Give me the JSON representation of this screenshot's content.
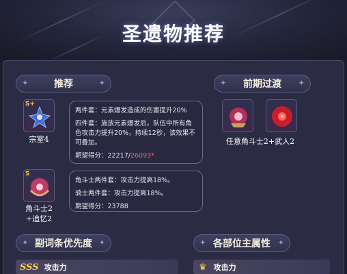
{
  "page": {
    "title": "圣遗物推荐"
  },
  "sections": {
    "recommend": "推荐",
    "early": "前期过渡",
    "substats": "副词条优先度",
    "main_stats": "各部位主属性"
  },
  "recommend": [
    {
      "badge": "S+",
      "name": "宗室4",
      "lines": [
        "两件套：元素爆发造成的伤害提升20%",
        "四件套：施放元素爆发后，队伍中所有角色攻击力提升20%，持续12秒，该效果不可叠加。"
      ],
      "score_label": "期望得分：",
      "score_a": "22217",
      "score_sep": "/",
      "score_b": "26093*"
    },
    {
      "badge": "S",
      "name": "角斗士2\n+追忆2",
      "lines": [
        "角斗士两件套：攻击力提高18%。",
        "骑士两件套：攻击力提高18%。"
      ],
      "score_label": "期望得分：",
      "score": "23788"
    }
  ],
  "early": {
    "label": "任意角斗士2+武人2"
  },
  "substat_top": {
    "rank": "SSS",
    "label": "攻击力"
  },
  "main_stat_top": {
    "label": "攻击力"
  },
  "colors": {
    "accent_red": "#ff5a66",
    "gold": "#ffd24a"
  },
  "icons": [
    "star-icon",
    "crown-icon"
  ]
}
